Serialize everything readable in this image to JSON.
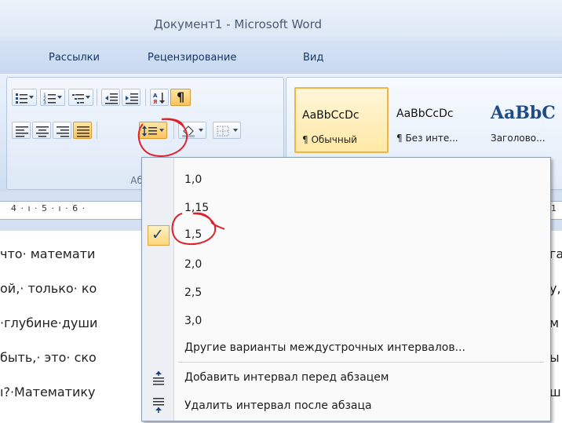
{
  "window": {
    "title": "Документ1 - Microsoft Word"
  },
  "tabs": [
    "Рассылки",
    "Рецензирование",
    "Вид"
  ],
  "ribbon": {
    "paragraph_group_label": "Абзац",
    "pilcrow_symbol": "¶"
  },
  "styles": [
    {
      "sample": "AaBbCcDc",
      "name": "¶ Обычный"
    },
    {
      "sample": "AaBbCcDc",
      "name": "¶ Без инте..."
    },
    {
      "sample": "AaBbC",
      "name": "Заголово..."
    }
  ],
  "ruler": {
    "text": "4 · ı · 5 · ı · 6 ·",
    "right": "1"
  },
  "document": {
    "lines": [
      "что· математи",
      "ой,· только· ко",
      "·глубине·души",
      "быть,· это· ско",
      "ı?·Математику"
    ],
    "right_fragments": [
      "га",
      "у,·",
      "м",
      "ы",
      "ш"
    ]
  },
  "menu": {
    "items": [
      "1,0",
      "1,15",
      "1,5",
      "2,0",
      "2,5",
      "3,0"
    ],
    "checked": "1,5",
    "more": "Другие варианты междустрочных интервалов...",
    "add_before": "Добавить интервал перед абзацем",
    "remove_after": "Удалить интервал после абзаца",
    "check_mark": "✓"
  },
  "colors": {
    "accent": "#f9c35f",
    "annotation": "#e0202a",
    "ribbon": "#dbe7f6"
  }
}
